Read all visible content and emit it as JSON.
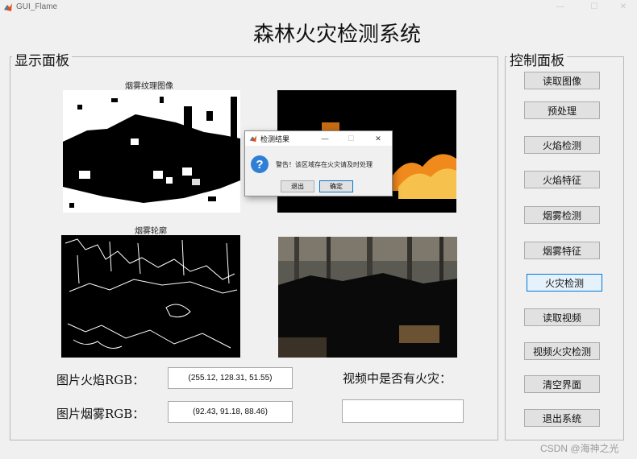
{
  "window": {
    "title": "GUI_Flame",
    "controls": {
      "minimize": "—",
      "maximize": "☐",
      "close": "✕"
    }
  },
  "app_title": "森林火灾检测系统",
  "display_panel": {
    "title": "显示面板",
    "captions": {
      "smoke_texture": "烟雾纹理图像",
      "smoke_contour": "烟雾轮廓"
    },
    "flame_rgb_label": "图片火焰RGB：",
    "flame_rgb_value": "(255.12, 128.31, 51.55)",
    "smoke_rgb_label": "图片烟雾RGB：",
    "smoke_rgb_value": "(92.43, 91.18, 88.46)",
    "video_fire_label": "视频中是否有火灾：",
    "video_fire_value": ""
  },
  "control_panel": {
    "title": "控制面板",
    "buttons": [
      "读取图像",
      "预处理",
      "火焰检测",
      "火焰特征",
      "烟雾检测",
      "烟雾特征",
      "火灾检测",
      "读取视频",
      "视频火灾检测",
      "清空界面",
      "退出系统"
    ]
  },
  "dialog": {
    "title": "检测结果",
    "icon": "question-icon",
    "message": "警告！该区域存在火灾请及时处理",
    "exit_label": "退出",
    "ok_label": "确定",
    "controls": {
      "minimize": "—",
      "maximize": "☐",
      "close": "✕"
    }
  },
  "watermark": "CSDN @海神之光",
  "colors": {
    "window_bg": "#f0f0f0",
    "dialog_icon": "#2f7fd6",
    "flame": "#f08a1c",
    "focus": "#0078d7"
  }
}
